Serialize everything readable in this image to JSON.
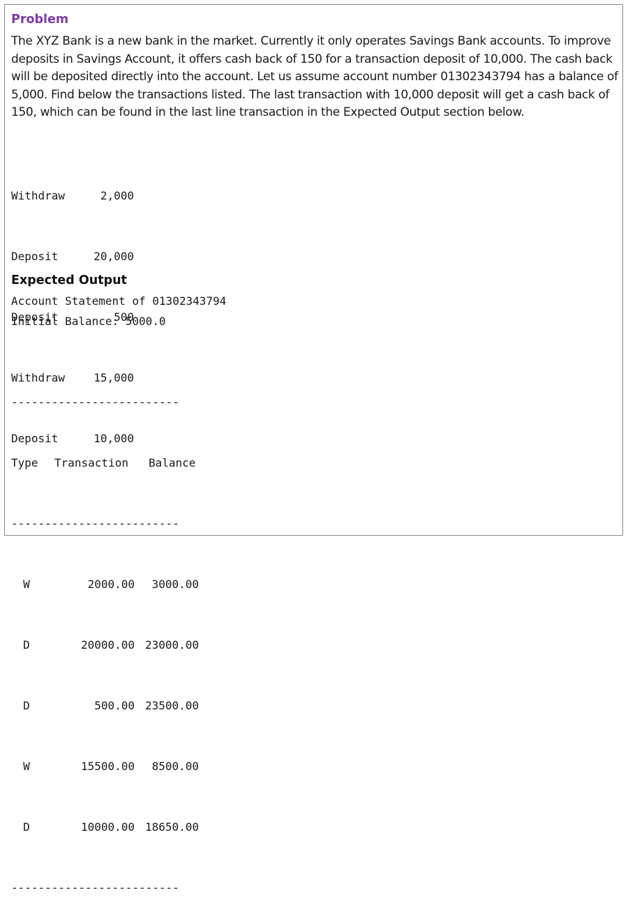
{
  "problem": {
    "heading": "Problem",
    "text": "The XYZ Bank is a new bank in the market. Currently it only operates Savings Bank accounts. To improve deposits in Savings Account, it offers cash back of 150 for a transaction deposit of 10,000. The cash back will be deposited directly into the account. Let us assume account number 01302343794 has a balance of 5,000. Find below the transactions listed. The last transaction with 10,000 deposit will get a cash back of 150, which can be found in the last line transaction in the Expected Output section below."
  },
  "transactions": [
    {
      "type": "Withdraw",
      "amount": "2,000"
    },
    {
      "type": "Deposit",
      "amount": "20,000"
    },
    {
      "type": "Deposit",
      "amount": "500"
    },
    {
      "type": "Withdraw",
      "amount": "15,000"
    },
    {
      "type": "Deposit",
      "amount": "10,000"
    }
  ],
  "expected_output": {
    "heading": "Expected Output",
    "statement_title": "Account Statement of 01302343794",
    "initial_balance": "Initial Balance: 5000.0",
    "separator": "-------------------------",
    "headers": {
      "type": "Type",
      "transaction": "Transaction",
      "balance": "Balance"
    },
    "rows": [
      {
        "type": "W",
        "amount": "2000.00",
        "balance": "3000.00"
      },
      {
        "type": "D",
        "amount": "20000.00",
        "balance": "23000.00"
      },
      {
        "type": "D",
        "amount": "500.00",
        "balance": "23500.00"
      },
      {
        "type": "W",
        "amount": "15500.00",
        "balance": "8500.00"
      },
      {
        "type": "D",
        "amount": "10000.00",
        "balance": "18650.00"
      }
    ]
  }
}
